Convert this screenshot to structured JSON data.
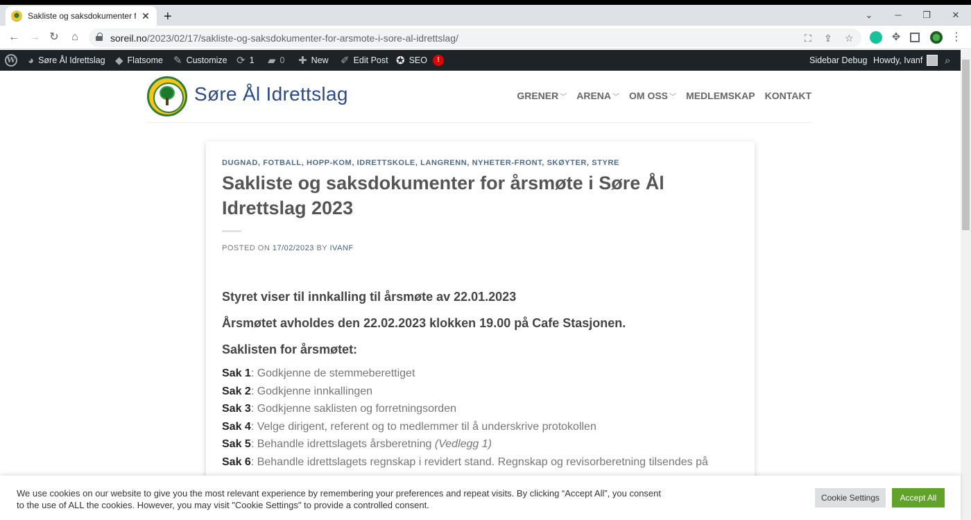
{
  "browser": {
    "tab_title": "Sakliste og saksdokumenter for å",
    "tab_close": "✕",
    "new_tab": "+",
    "url_host": "soreil.no",
    "url_path": "/2023/02/17/sakliste-og-saksdokumenter-for-arsmote-i-sore-al-idrettslag/"
  },
  "adminbar": {
    "site_name": "Søre Ål Idrettslag",
    "flatsome": "Flatsome",
    "customize": "Customize",
    "updates_count": "1",
    "comments_count": "0",
    "new": "New",
    "edit_post": "Edit Post",
    "seo": "SEO",
    "seo_badge": "!",
    "sidebar_debug": "Sidebar Debug",
    "howdy": "Howdy, Ivanf"
  },
  "header": {
    "site_title": "Søre Ål Idrettslag",
    "nav": [
      {
        "label": "GRENER",
        "has_dropdown": true
      },
      {
        "label": "ARENA",
        "has_dropdown": true
      },
      {
        "label": "OM OSS",
        "has_dropdown": true
      },
      {
        "label": "MEDLEMSKAP",
        "has_dropdown": false
      },
      {
        "label": "KONTAKT",
        "has_dropdown": false
      }
    ]
  },
  "post": {
    "categories": "DUGNAD, FOTBALL, HOPP-KOM, IDRETTSKOLE, LANGRENN, NYHETER-FRONT, SKØYTER, STYRE",
    "title": "Sakliste og saksdokumenter for årsmøte i Søre Ål Idrettslag 2023",
    "posted_on_label": "POSTED ON ",
    "date": "17/02/2023",
    "by_label": " BY ",
    "author": "IVANF",
    "lead1": "Styret viser til innkalling til årsmøte av 22.01.2023",
    "lead2": "Årsmøtet avholdes den 22.02.2023 klokken 19.00 på Cafe Stasjonen.",
    "lead3": "Saklisten for årsmøtet:",
    "saker": [
      {
        "label": "Sak 1",
        "text": ": Godkjenne de stemmeberettiget",
        "note": ""
      },
      {
        "label": "Sak 2",
        "text": ": Godkjenne innkallingen",
        "note": ""
      },
      {
        "label": "Sak 3",
        "text": ": Godkjenne saklisten og forretningsorden",
        "note": ""
      },
      {
        "label": "Sak 4",
        "text": ": Velge dirigent, referent og to medlemmer til å underskrive protokollen",
        "note": ""
      },
      {
        "label": "Sak 5",
        "text": ": Behandle idrettslagets årsberetning ",
        "note": "(Vedlegg 1)"
      },
      {
        "label": "Sak 6",
        "text": ": Behandle idrettslagets regnskap i revidert stand. Regnskap og revisorberetning tilsendes på",
        "note": ""
      }
    ]
  },
  "cookie": {
    "message": "We use cookies on our website to give you the most relevant experience by remembering your preferences and repeat visits. By clicking “Accept All”, you consent to the use of ALL the cookies. However, you may visit \"Cookie Settings\" to provide a controlled consent.",
    "settings_label": "Cookie Settings",
    "accept_label": "Accept All"
  },
  "colors": {
    "admin_bar": "#1d2327",
    "site_title": "#2a4a8a",
    "accept": "#61a229",
    "seo_badge": "#e10000"
  }
}
